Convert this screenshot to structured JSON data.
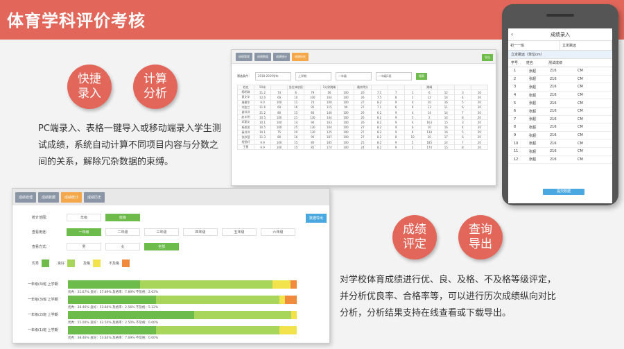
{
  "header": {
    "title": "体育学科评价考核"
  },
  "circles": [
    "快捷录入",
    "计算分析",
    "成绩评定",
    "查询导出"
  ],
  "desc1": "PC端录入、表格一键导入或移动端录入学生测试成绩，系统自动计算不同项目内容与分数之间的关系，解除冗杂数据的束缚。",
  "desc2": "对学校体育成绩进行优、良、及格、不及格等级评定，并分析优良率、合格率等，可以进行历次成绩纵向对比分析，分析结果支持在线查看或下载导出。",
  "shot1": {
    "tabs": [
      "成绩管理",
      "成绩数据",
      "成绩统计",
      "成绩历史"
    ],
    "export": "导出",
    "filter": {
      "label": "筛选条件：",
      "year": "2018-2019学年",
      "term": "上学期",
      "grade": "一年级",
      "cls": "一年级1班",
      "btn": "搜索"
    },
    "headers": [
      "姓名",
      "50米",
      "",
      "坐位体前屈",
      "",
      "1分钟跳绳",
      "",
      "最终得分",
      "",
      "",
      "",
      "跳绳",
      "",
      "",
      "",
      "",
      "",
      "总得分"
    ],
    "rows": [
      [
        "杨明珠",
        "11.2",
        "74",
        "6",
        "79",
        "16",
        "100",
        "20",
        "7.1",
        "7",
        "1",
        "6",
        "12",
        "3",
        "10"
      ],
      [
        "夏文华",
        "12.0",
        "60",
        "10",
        "100",
        "104",
        "100",
        "26",
        "7.5",
        "8",
        "2",
        "12",
        "14",
        "4",
        "20"
      ],
      [
        "周雅华",
        "9.0",
        "100",
        "11",
        "74",
        "100",
        "100",
        "27",
        "8.2",
        "9",
        "4",
        "10",
        "16",
        "5",
        "20"
      ],
      [
        "刘金兰",
        "11.6",
        "60",
        "16",
        "95",
        "115",
        "90",
        "27",
        "7.1",
        "6",
        "9",
        "13",
        "11",
        "6",
        "20"
      ],
      [
        "谢洋洋",
        "11.2",
        "80",
        "15",
        "80",
        "140",
        "100",
        "26",
        "6.2",
        "9",
        "4",
        "14",
        "14",
        "7",
        "20"
      ],
      [
        "赵丰明",
        "10.5",
        "100",
        "21",
        "130",
        "144",
        "100",
        "26",
        "8.2",
        "9",
        "5",
        "2",
        "14",
        "8",
        "20"
      ],
      [
        "邓丽文",
        "10.1",
        "100",
        "14",
        "90",
        "163",
        "100",
        "26",
        "8.2",
        "9",
        "4",
        "163",
        "15",
        "3",
        "20"
      ],
      [
        "杨思思",
        "10.5",
        "100",
        "25",
        "130",
        "104",
        "100",
        "27",
        "8.2",
        "9",
        "6",
        "10",
        "16",
        "4",
        "20"
      ],
      [
        "秦洋洋",
        "10.1",
        "75",
        "20",
        "130",
        "125",
        "100",
        "27",
        "8.2",
        "9",
        "6",
        "130",
        "16",
        "5",
        "20"
      ],
      [
        "张欣蓓",
        "11.3",
        "80",
        "16",
        "90",
        "187",
        "100",
        "27",
        "8.2",
        "8",
        "10",
        "20",
        "17",
        "6",
        "20"
      ],
      [
        "程锐轩",
        "9.9",
        "100",
        "15",
        "80",
        "185",
        "100",
        "25",
        "8.2",
        "9",
        "5",
        "185",
        "14",
        "7",
        "20"
      ],
      [
        "王星",
        "9.9",
        "100",
        "15",
        "85",
        "174",
        "100",
        "24",
        "8.2",
        "9",
        "2",
        "174",
        "15",
        "8",
        "20"
      ]
    ]
  },
  "shot2": {
    "tabs": [
      "成绩管理",
      "成绩数据",
      "成绩统计",
      "成绩历史"
    ],
    "export": "数据导出",
    "row1": {
      "label": "统计范围：",
      "opts": [
        "年级",
        "班级"
      ]
    },
    "row2": {
      "label": "查看用途：",
      "opts": [
        "一年级",
        "二年级",
        "三年级",
        "四年级",
        "五年级",
        "六年级"
      ]
    },
    "row3": {
      "label": "查看方式：",
      "opts": [
        "男",
        "女",
        "全部"
      ]
    },
    "legend": [
      "优秀",
      "良好",
      "及格",
      "不及格"
    ],
    "bars": [
      {
        "label": "一年级(4)班 上学期",
        "stats": "优秀：31.67%  良好：57.89%  及格率：7.89%  不及格：2.63%"
      },
      {
        "label": "一年级(3)班 上学期",
        "stats": "优秀：38.46%  良好：53.84%  及格率：2.56%  不及格：5.12%"
      },
      {
        "label": "一年级(2)班 上学期",
        "stats": "优秀：55.00%  良好：42.50%  及格率：2.50%  不及格：0.00%"
      },
      {
        "label": "一年级(1)班 上学期",
        "stats": "优秀：38.46%  良好：53.84%  及格率：7.69%  不及格：0.00%"
      }
    ],
    "bar_values": [
      [
        31.67,
        57.89,
        7.89,
        2.63
      ],
      [
        38.46,
        53.84,
        2.56,
        5.12
      ],
      [
        55.0,
        42.5,
        2.5,
        0.0
      ],
      [
        38.46,
        53.84,
        7.69,
        0.0
      ]
    ],
    "colors": [
      "#6dbb4a",
      "#a8d65a",
      "#f2e24b",
      "#f08a3c"
    ]
  },
  "phone": {
    "title": "成绩录入",
    "sel1": "初一一班",
    "sel2": "立定跳远",
    "item": "立定跳远（单位cm）",
    "cols": [
      "学号",
      "姓名",
      "测试成绩"
    ],
    "rows": [
      [
        "1",
        "张超",
        "216",
        "CM"
      ],
      [
        "2",
        "张超",
        "216",
        "CM"
      ],
      [
        "3",
        "张超",
        "216",
        "CM"
      ],
      [
        "4",
        "张超",
        "216",
        "CM"
      ],
      [
        "5",
        "张超",
        "216",
        "CM"
      ],
      [
        "6",
        "张超",
        "216",
        "CM"
      ],
      [
        "7",
        "张超",
        "216",
        "CM"
      ],
      [
        "8",
        "张超",
        "216",
        "CM"
      ],
      [
        "9",
        "张超",
        "216",
        "CM"
      ],
      [
        "10",
        "张超",
        "216",
        "CM"
      ],
      [
        "11",
        "张超",
        "216",
        "CM"
      ],
      [
        "12",
        "张超",
        "216",
        "CM"
      ]
    ],
    "submit": "提交数据"
  }
}
